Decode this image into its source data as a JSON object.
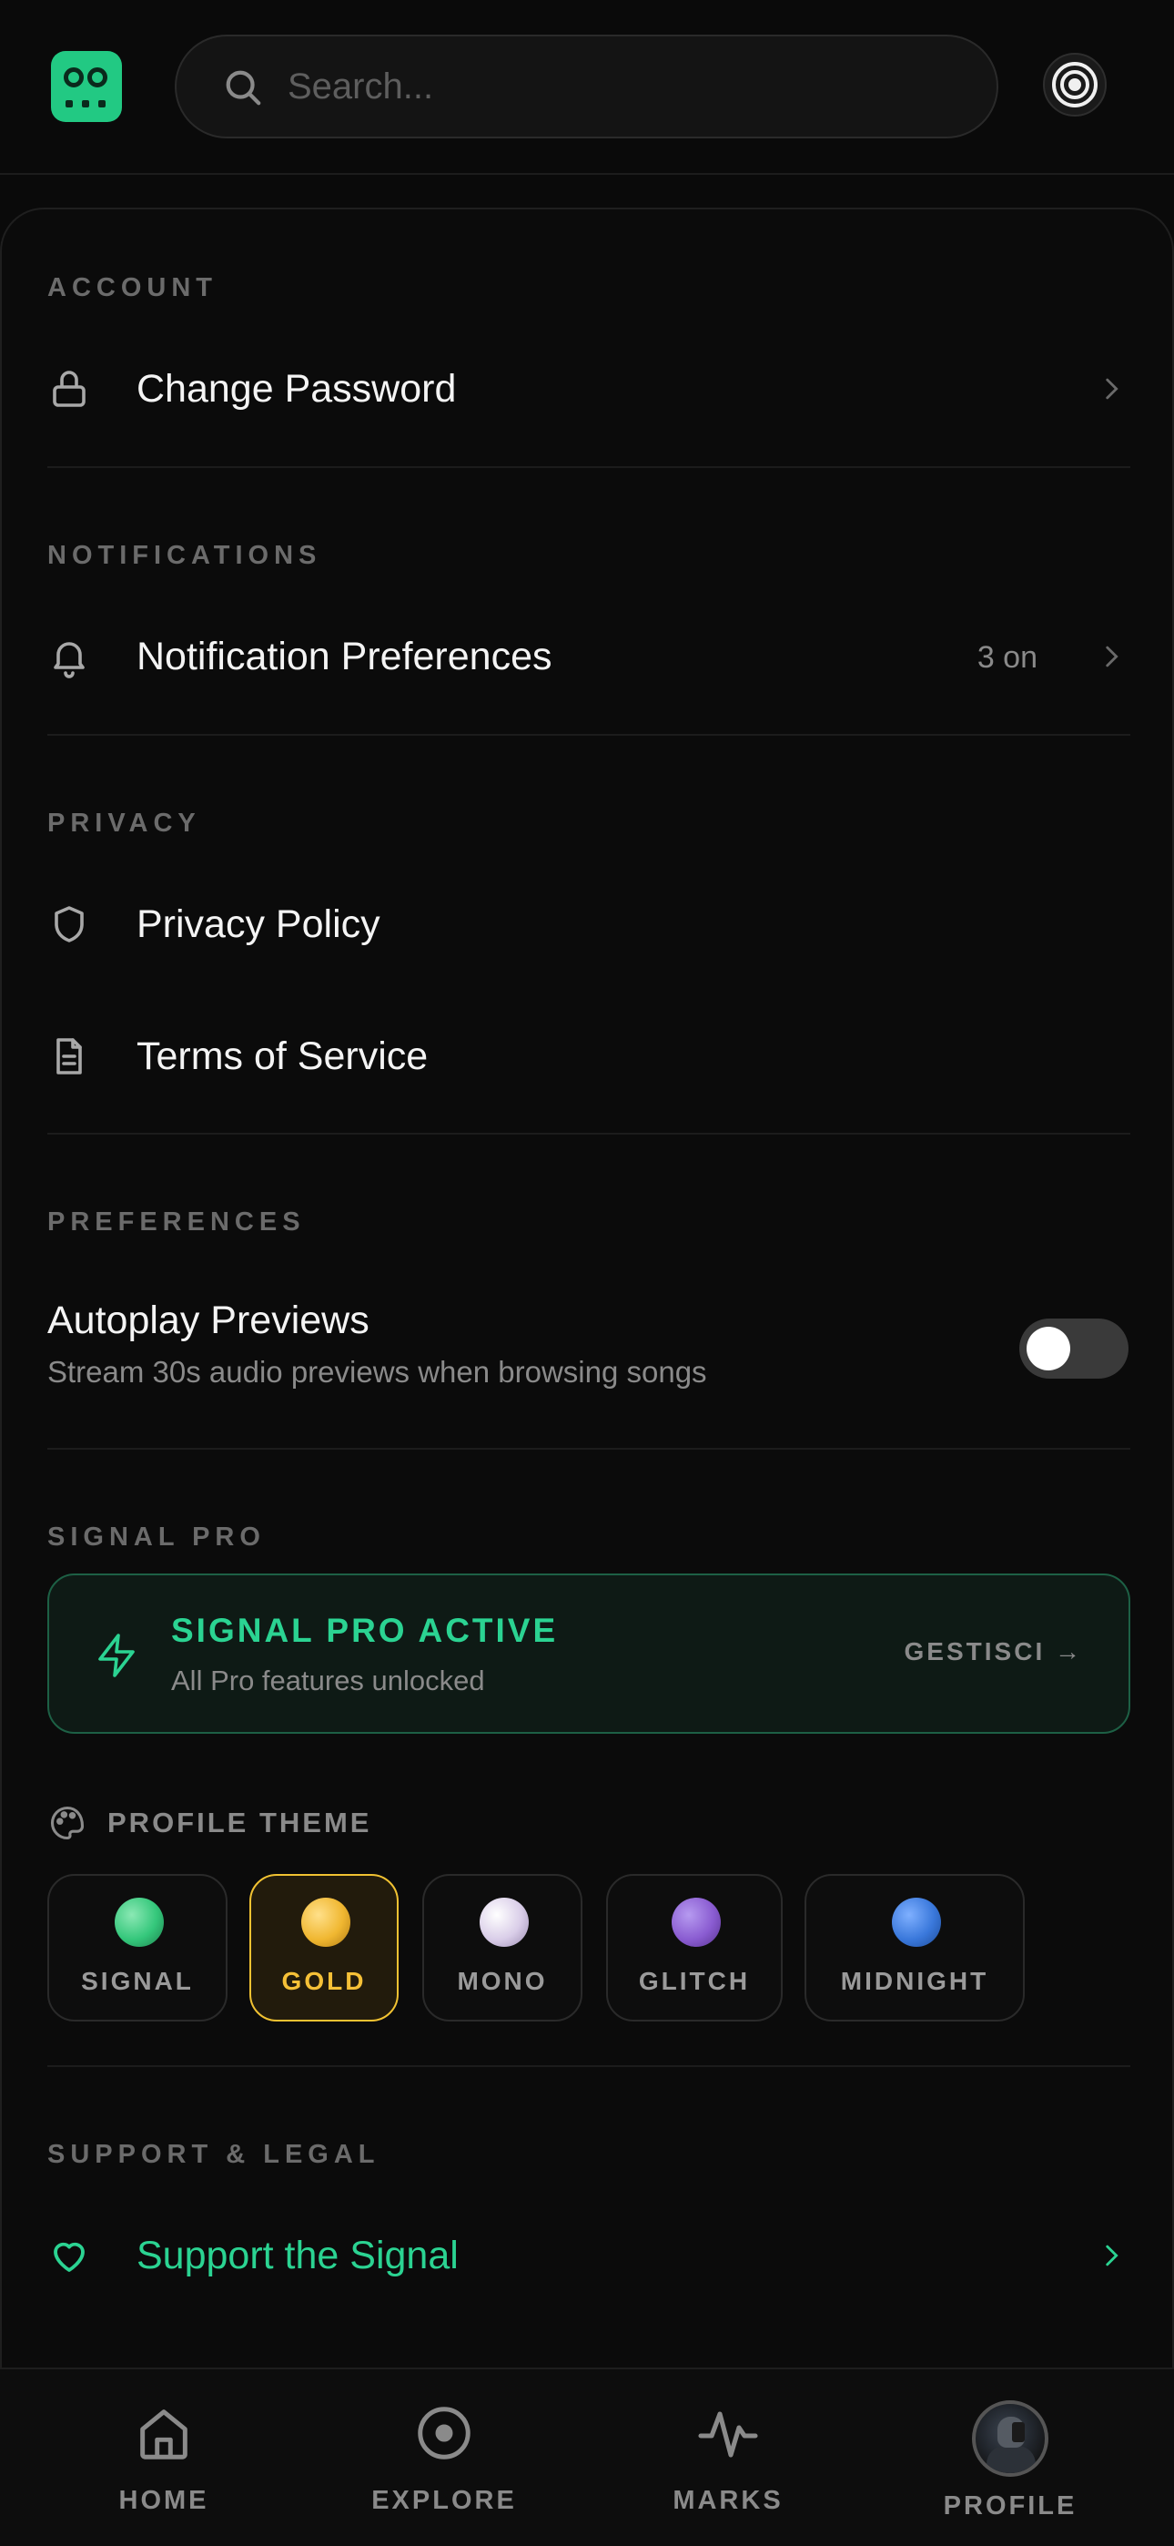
{
  "header": {
    "search_placeholder": "Search...",
    "logo_icon": "robot-face-icon",
    "right_icon": "target-icon"
  },
  "sections": {
    "account": {
      "title": "ACCOUNT",
      "items": [
        {
          "label": "Change Password",
          "icon": "lock-icon"
        }
      ]
    },
    "notifications": {
      "title": "NOTIFICATIONS",
      "items": [
        {
          "label": "Notification Preferences",
          "meta": "3 on",
          "icon": "bell-icon"
        }
      ]
    },
    "privacy": {
      "title": "PRIVACY",
      "items": [
        {
          "label": "Privacy Policy",
          "icon": "shield-icon"
        },
        {
          "label": "Terms of Service",
          "icon": "document-icon"
        }
      ]
    },
    "preferences": {
      "title": "PREFERENCES",
      "autoplay": {
        "title": "Autoplay Previews",
        "subtitle": "Stream 30s audio previews when browsing songs",
        "enabled": false
      }
    },
    "signal_pro": {
      "title": "SIGNAL PRO",
      "status_title": "SIGNAL PRO ACTIVE",
      "status_subtitle": "All Pro features unlocked",
      "manage_label": "GESTISCI →"
    },
    "profile_theme": {
      "title": "PROFILE THEME",
      "selected": "GOLD",
      "themes": [
        {
          "name": "SIGNAL",
          "color": "#34c77b"
        },
        {
          "name": "GOLD",
          "color": "#f0b731"
        },
        {
          "name": "MONO",
          "color": "#d9cde8"
        },
        {
          "name": "GLITCH",
          "color": "#8a5cd1"
        },
        {
          "name": "MIDNIGHT",
          "color": "#3a78db"
        }
      ]
    },
    "support": {
      "title": "SUPPORT & LEGAL",
      "items": [
        {
          "label": "Support the Signal",
          "icon": "heart-icon"
        }
      ]
    }
  },
  "nav": {
    "items": [
      {
        "label": "HOME",
        "icon": "home-icon"
      },
      {
        "label": "EXPLORE",
        "icon": "disc-icon"
      },
      {
        "label": "MARKS",
        "icon": "pulse-icon"
      },
      {
        "label": "PROFILE",
        "icon": "avatar"
      }
    ]
  },
  "colors": {
    "accent": "#2bd392",
    "background": "#0a0a0a",
    "gold": "#f5c037"
  }
}
